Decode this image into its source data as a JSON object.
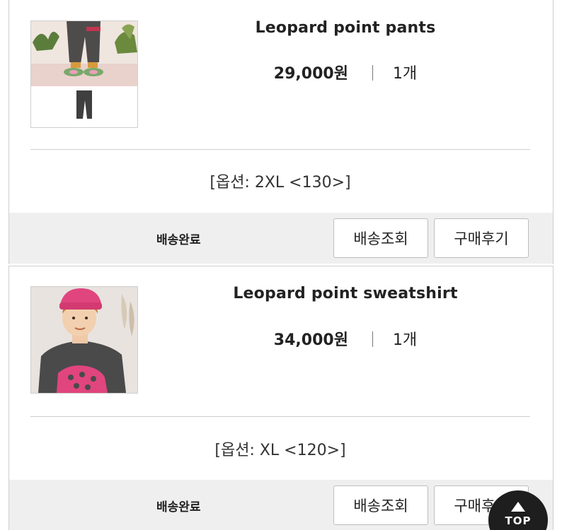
{
  "orders": [
    {
      "title": "Leopard point pants",
      "price": "29,000원",
      "quantity": "1개",
      "option": "[옵션: 2XL <130>]",
      "status": "배송완료",
      "track_label": "배송조회",
      "review_label": "구매후기",
      "image_desc": "pants-photo"
    },
    {
      "title": "Leopard point sweatshirt",
      "price": "34,000원",
      "quantity": "1개",
      "option": "[옵션: XL <120>]",
      "status": "배송완료",
      "track_label": "배송조회",
      "review_label": "구매후기",
      "image_desc": "sweatshirt-photo"
    }
  ],
  "top_button": {
    "label": "TOP"
  },
  "colors": {
    "footer_bg": "#efefef",
    "border": "#cfcfcf",
    "sweatshirt": "#4a4a4a",
    "leopard_pink": "#e0457e",
    "top_button": "#1e1e1e"
  }
}
